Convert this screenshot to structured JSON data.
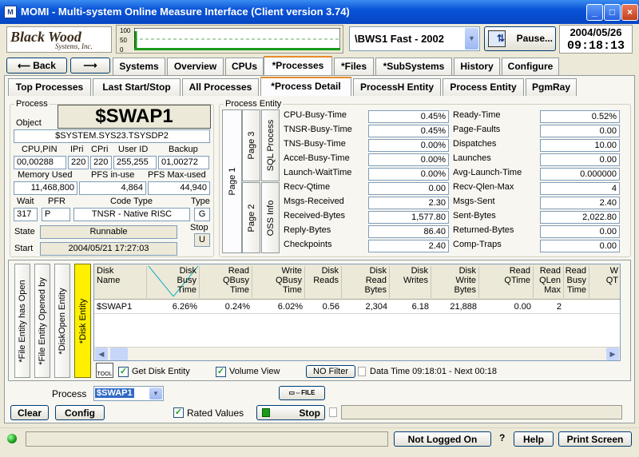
{
  "window": {
    "title": "MOMI - Multi-system Online Measure Interface (Client version 3.74)",
    "minimize": "_",
    "maximize": "□",
    "close": "×"
  },
  "header": {
    "logo_top": "Black Wood",
    "logo_bottom": "Systems, Inc.",
    "graph_ticks": [
      "100",
      "50",
      "0"
    ],
    "system_select": "\\BWS1 Fast - 2002",
    "pause_label": "Pause...",
    "date": "2004/05/26",
    "time": "09:18:13",
    "back_label": "Back"
  },
  "main_tabs": [
    "Systems",
    "Overview",
    "CPUs",
    "*Processes",
    "*Files",
    "*SubSystems",
    "History",
    "Configure"
  ],
  "sub_tabs": [
    "Top Processes",
    "Last Start/Stop",
    "All Processes",
    "*Process Detail",
    "ProcessH Entity",
    "Process Entity",
    "PgmRay"
  ],
  "process": {
    "group_label": "Process",
    "object_label": "Object",
    "name": "$SWAP1",
    "object": "$SYSTEM.SYS23.TSYSDP2",
    "labels": {
      "cpu_pin": "CPU,PIN",
      "ipri": "IPri",
      "cpri": "CPri",
      "user_id": "User ID",
      "backup": "Backup",
      "mem_used": "Memory Used",
      "pfs_in_use": "PFS in-use",
      "pfs_max": "PFS Max-used",
      "wait": "Wait",
      "pfr": "PFR",
      "code_type": "Code Type",
      "type": "Type",
      "state": "State",
      "stop": "Stop",
      "start": "Start"
    },
    "values": {
      "cpu_pin": "00,00288",
      "ipri": "220",
      "cpri": "220",
      "user_id": "255,255",
      "backup": "01,00272",
      "mem_used": "11,468,800",
      "pfs_in_use": "4,864",
      "pfs_max": "44,940",
      "wait": "317",
      "pfr": "P",
      "code_type": "TNSR - Native RISC",
      "type": "G",
      "state": "Runnable",
      "stop": "U",
      "start": "2004/05/21 17:27:03"
    }
  },
  "entity": {
    "group_label": "Process Entity",
    "vtabs": [
      "Page 1",
      "Page 3",
      "Page 2",
      "SQL Process",
      "OSS Info"
    ],
    "left": [
      {
        "label": "CPU-Busy-Time",
        "value": "0.45%"
      },
      {
        "label": "TNSR-Busy-Time",
        "value": "0.45%"
      },
      {
        "label": "TNS-Busy-Time",
        "value": "0.00%"
      },
      {
        "label": "Accel-Busy-Time",
        "value": "0.00%"
      },
      {
        "label": "Launch-WaitTime",
        "value": "0.00%"
      },
      {
        "label": "Recv-Qtime",
        "value": "0.00"
      },
      {
        "label": "Msgs-Received",
        "value": "2.30"
      },
      {
        "label": "Received-Bytes",
        "value": "1,577.80"
      },
      {
        "label": "Reply-Bytes",
        "value": "86.40"
      },
      {
        "label": "Checkpoints",
        "value": "2.40"
      }
    ],
    "right": [
      {
        "label": "Ready-Time",
        "value": "0.52%"
      },
      {
        "label": "Page-Faults",
        "value": "0.00"
      },
      {
        "label": "Dispatches",
        "value": "10.00"
      },
      {
        "label": "Launches",
        "value": "0.00"
      },
      {
        "label": "Avg-Launch-Time",
        "value": "0.000000"
      },
      {
        "label": "Recv-Qlen-Max",
        "value": "4"
      },
      {
        "label": "Msgs-Sent",
        "value": "2.40"
      },
      {
        "label": "Sent-Bytes",
        "value": "2,022.80"
      },
      {
        "label": "Returned-Bytes",
        "value": "0.00"
      },
      {
        "label": "Comp-Traps",
        "value": "0.00"
      }
    ]
  },
  "disk": {
    "vtabs": [
      "*File Entity has Open",
      "*File Entity Opened by",
      "*DiskOpen Entity",
      "*Disk Entity"
    ],
    "columns": [
      "Disk\nName",
      "Disk\nBusy\nTime",
      "Read\nQBusy\nTime",
      "Write\nQBusy\nTime",
      "Disk\nReads",
      "Disk\nRead\nBytes",
      "Disk\nWrites",
      "Disk\nWrite\nBytes",
      "Read\nQTime",
      "Read\nQLen\nMax",
      "Read\nBusy\nTime",
      "W\nQT"
    ],
    "row": [
      "$SWAP1",
      "6.26%",
      "0.24%",
      "6.02%",
      "0.56",
      "2,304",
      "6.18",
      "21,888",
      "0.00",
      "2",
      "",
      ""
    ],
    "get_disk_entity": "Get Disk Entity",
    "volume_view": "Volume View",
    "filter": "NO Filter",
    "data_time": "Data Time 09:18:01 - Next 00:18"
  },
  "footer": {
    "process_label": "Process",
    "process_value": "$SWAP1",
    "clear": "Clear",
    "config": "Config",
    "rated": "Rated Values",
    "stop": "Stop",
    "not_logged": "Not Logged On",
    "question": "?",
    "help": "Help",
    "print": "Print Screen",
    "file_icon": "FILE"
  }
}
